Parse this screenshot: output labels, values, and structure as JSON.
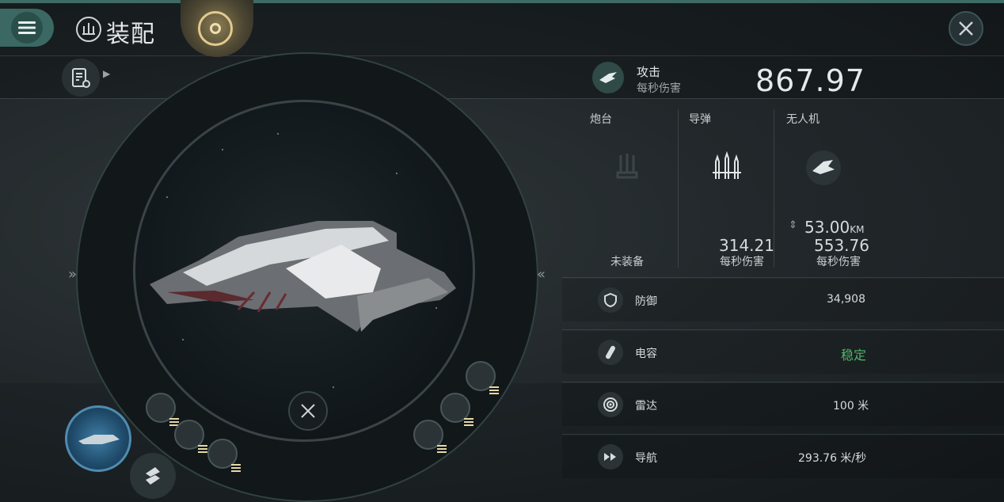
{
  "header": {
    "title": "装配"
  },
  "attack": {
    "label": "攻击",
    "sublabel": "每秒伤害",
    "value": "867.97"
  },
  "weapons": [
    {
      "label": "炮台",
      "status": "未装备"
    },
    {
      "label": "导弹",
      "value": "314.21",
      "unit": "每秒伤害"
    },
    {
      "label": "无人机",
      "range": "53.00",
      "range_unit": "KM",
      "value": "553.76",
      "unit": "每秒伤害"
    }
  ],
  "stats": [
    {
      "label": "防御",
      "value": "34,908",
      "icon": "shield-icon"
    },
    {
      "label": "电容",
      "value": "稳定",
      "icon": "capacitor-icon",
      "color": "#4fb56b"
    },
    {
      "label": "雷达",
      "value": "100 米",
      "icon": "radar-icon"
    },
    {
      "label": "导航",
      "value": "293.76 米/秒",
      "icon": "navigation-icon"
    }
  ],
  "colors": {
    "accent": "#3b6862",
    "gold": "#e3c98d",
    "stable": "#4fb56b"
  }
}
